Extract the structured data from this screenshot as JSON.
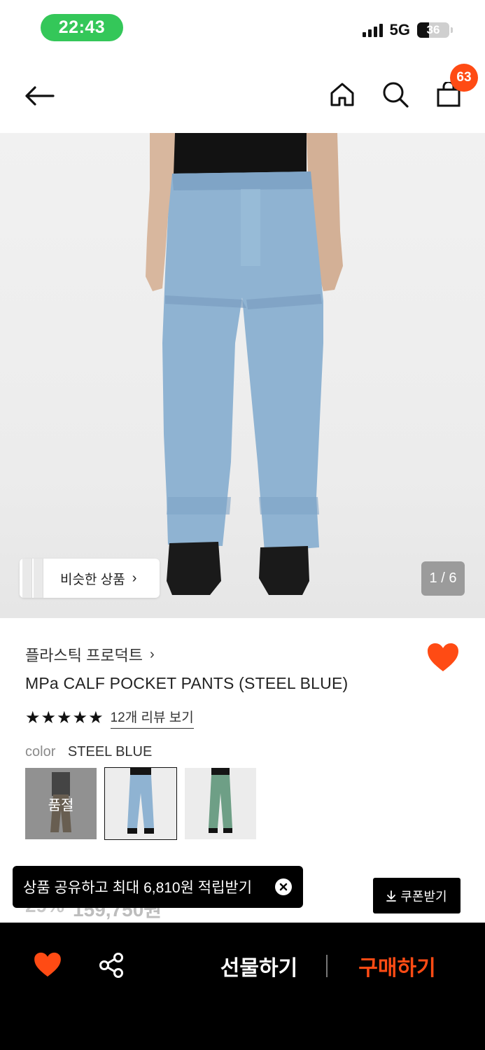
{
  "status_bar": {
    "time": "22:43",
    "network": "5G",
    "battery": "36",
    "battery_level": 0.36
  },
  "header": {
    "back_icon": "arrow-left-icon",
    "home_icon": "home-icon",
    "search_icon": "search-icon",
    "cart_icon": "shopping-bag-icon",
    "cart_count": "63"
  },
  "gallery": {
    "similar_label": "비슷한 상품",
    "similar_chevron": "›",
    "page_indicator": "1 / 6",
    "current_page": 1,
    "total_pages": 6
  },
  "product": {
    "brand": "플라스틱 프로덕트",
    "brand_chevron": "›",
    "title": "MPa CALF POCKET PANTS (STEEL BLUE)",
    "rating_stars": 5,
    "review_link": "12개 리뷰 보기",
    "color_label": "color",
    "color_value": "STEEL BLUE",
    "wishlisted": true,
    "accent_color": "#ff4b14",
    "swatches": [
      {
        "name": "black-brown",
        "soldout_label": "품절",
        "selected": false
      },
      {
        "name": "steel-blue",
        "selected": true
      },
      {
        "name": "green",
        "selected": false
      }
    ],
    "price_partial": {
      "discount": "29%",
      "price": "159,750원"
    }
  },
  "toast": {
    "text": "상품 공유하고 최대 6,810원 적립받기",
    "close_icon": "close-circle-icon"
  },
  "coupon": {
    "label": "쿠폰받기",
    "icon": "download-icon"
  },
  "bottom_bar": {
    "heart_icon": "heart-icon",
    "share_icon": "share-icon",
    "gift_label": "선물하기",
    "buy_label": "구매하기"
  }
}
